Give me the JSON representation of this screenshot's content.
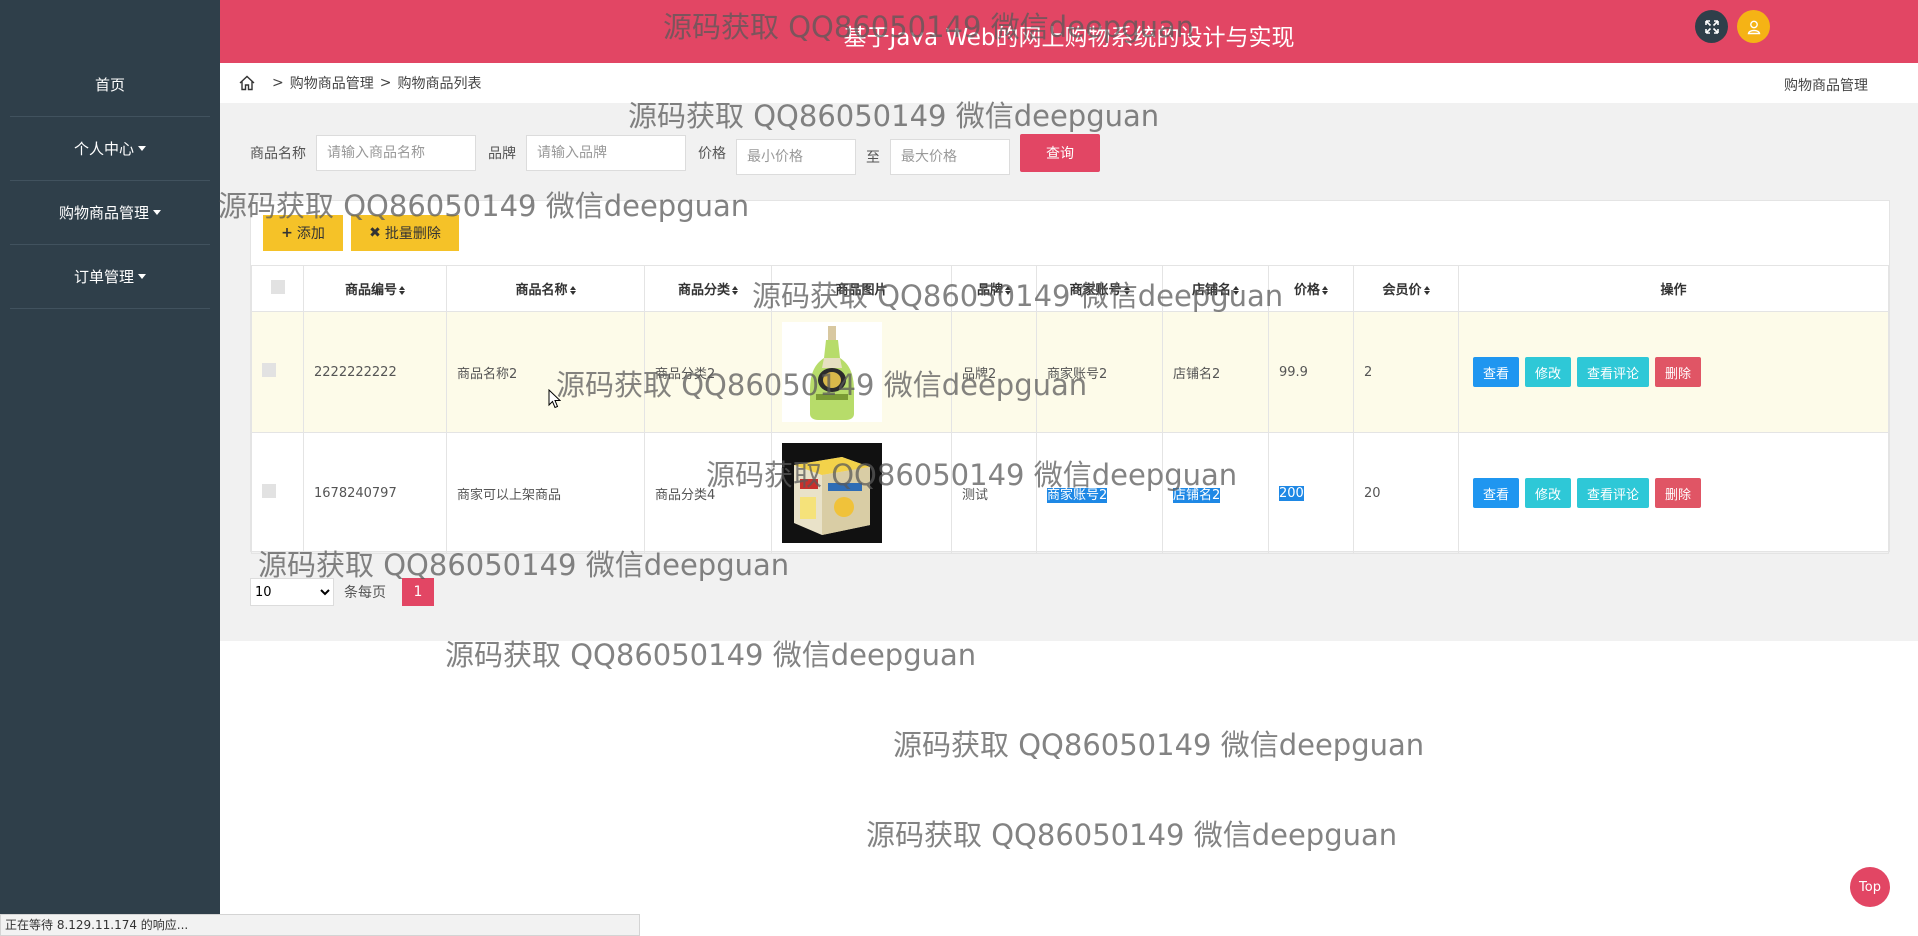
{
  "app": {
    "title": "基于Java Web的网上购物系统的设计与实现"
  },
  "sidebar": {
    "items": [
      {
        "label": "首页"
      },
      {
        "label": "个人中心"
      },
      {
        "label": "购物商品管理"
      },
      {
        "label": "订单管理"
      }
    ]
  },
  "breadcrumb": {
    "items": [
      "购物商品管理",
      "购物商品列表"
    ],
    "right": "购物商品管理"
  },
  "search": {
    "name_label": "商品名称",
    "name_placeholder": "请输入商品名称",
    "brand_label": "品牌",
    "brand_placeholder": "请输入品牌",
    "price_label": "价格",
    "min_placeholder": "最小价格",
    "to_label": "至",
    "max_placeholder": "最大价格",
    "query_label": "查询"
  },
  "toolbar": {
    "add_label": "添加",
    "batch_delete_label": "批量删除"
  },
  "table": {
    "headers": [
      "商品编号",
      "商品名称",
      "商品分类",
      "商品图片",
      "品牌",
      "商家账号",
      "店铺名",
      "价格",
      "会员价",
      "操作"
    ],
    "rows": [
      {
        "id": "2222222222",
        "name": "商品名称2",
        "category": "商品分类2",
        "brand": "品牌2",
        "merchant": "商家账号2",
        "shop": "店铺名2",
        "price": "99.9",
        "member_price": "2"
      },
      {
        "id": "1678240797",
        "name": "商家可以上架商品",
        "category": "商品分类4",
        "brand": "测试",
        "merchant": "商家账号2",
        "shop": "店铺名2",
        "price": "200",
        "member_price": "20"
      }
    ],
    "actions": {
      "view": "查看",
      "edit": "修改",
      "comments": "查看评论",
      "delete": "删除"
    }
  },
  "pager": {
    "page_size": "10",
    "per_page_label": "条每页",
    "current_page": "1"
  },
  "top_button": "Top",
  "status_bar": "正在等待 8.129.11.174 的响应...",
  "watermark": "源码获取 QQ86050149 微信deepguan",
  "colors": {
    "sidebar": "#2f3f4a",
    "accent": "#e24664",
    "yellow_button": "#f5c228",
    "view_button": "#1f96f0",
    "edit_button": "#2ec8d7",
    "delete_button": "#e05565"
  }
}
